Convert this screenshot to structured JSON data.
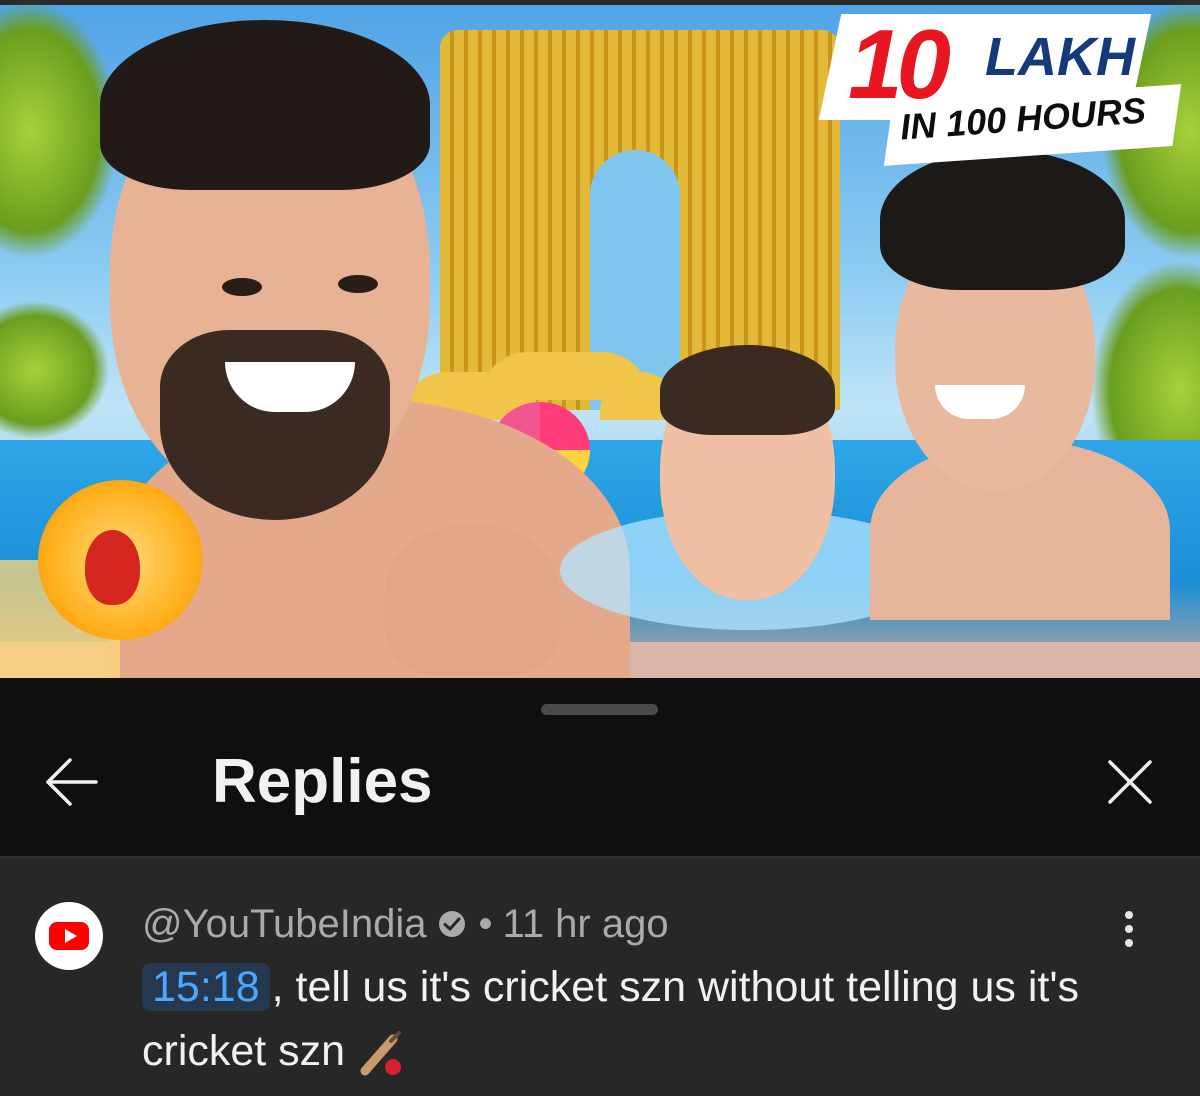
{
  "thumbnail": {
    "badge_number": "10",
    "badge_unit": "LAKH",
    "badge_subtitle": "IN 100 HOURS"
  },
  "panel": {
    "title": "Replies",
    "back_icon": "arrow-left-icon",
    "close_icon": "close-icon"
  },
  "comment": {
    "author": "@YouTubeIndia",
    "verified_icon": "verified-check-icon",
    "separator": "•",
    "time_ago": "11 hr ago",
    "timestamp_link": "15:18",
    "text": ", tell us it's cricket szn without telling us it's cricket szn",
    "emoji_icon": "cricket-bat-ball-icon",
    "more_icon": "more-vertical-icon"
  },
  "colors": {
    "background": "#0f0f0f",
    "comment_bg": "#272727",
    "link": "#4aa8ff",
    "youtube_red": "#ff0000"
  }
}
